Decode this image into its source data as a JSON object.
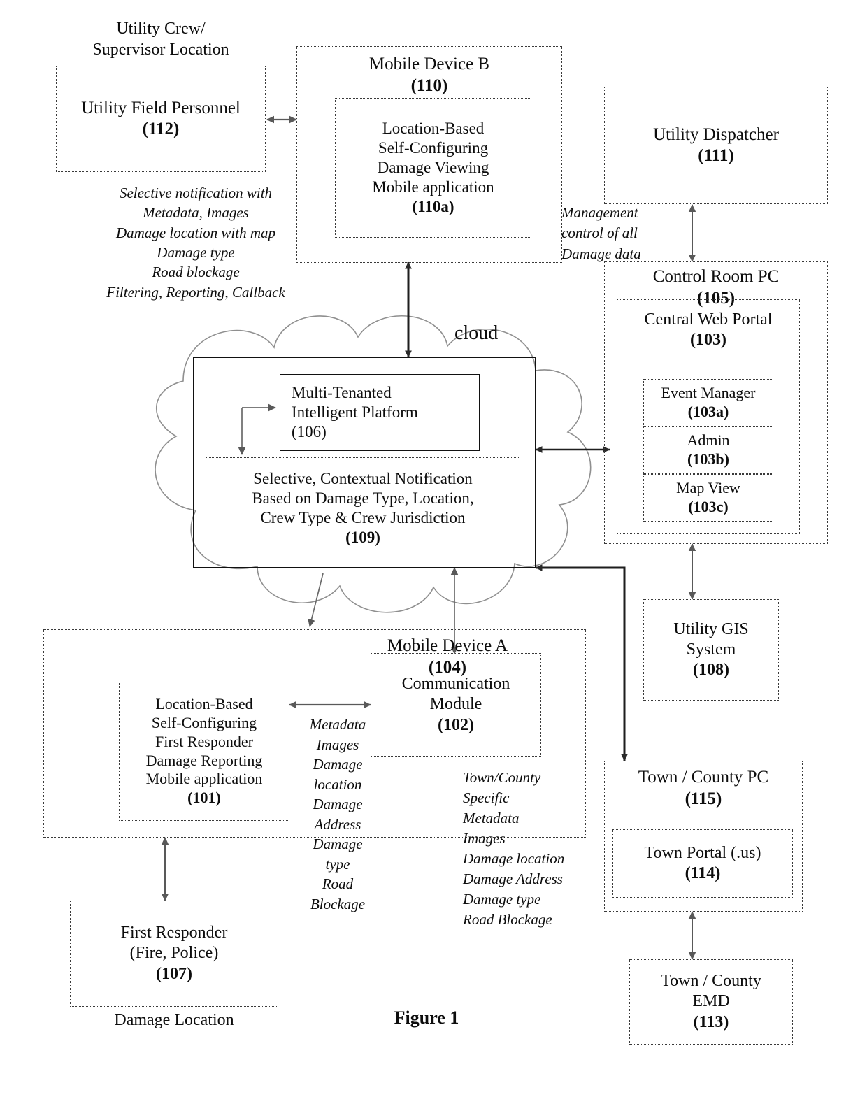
{
  "figure": {
    "caption": "Figure 1",
    "cloud_label": "cloud"
  },
  "labels": {
    "utility_crew_location": "Utility Crew/\nSupervisor Location",
    "damage_location": "Damage Location",
    "selective_notification": "Selective notification with\nMetadata, Images\nDamage location with map\nDamage type\nRoad blockage\nFiltering, Reporting, Callback",
    "management_control": "Management\ncontrol of all\nDamage data",
    "metadata_left": "Metadata\nImages\nDamage\nlocation\nDamage\nAddress\nDamage\ntype\nRoad Blockage",
    "town_county_metadata": "Town/County\nSpecific\nMetadata\nImages\nDamage location\nDamage Address\nDamage type\nRoad Blockage"
  },
  "boxes": {
    "utility_field_personnel": {
      "title": "Utility Field Personnel",
      "number": "(112)"
    },
    "mobile_device_b": {
      "title": "Mobile Device B",
      "number": "(110)"
    },
    "damage_viewing_app": {
      "lines": [
        "Location-Based",
        "Self-Configuring",
        "Damage Viewing",
        "Mobile application"
      ],
      "number": "(110a)"
    },
    "utility_dispatcher": {
      "title": "Utility Dispatcher",
      "number": "(111)"
    },
    "control_room_pc": {
      "title": "Control Room PC",
      "number": "(105)"
    },
    "central_web_portal": {
      "title": "Central Web Portal",
      "number": "(103)"
    },
    "event_manager": {
      "title": "Event Manager",
      "number": "(103a)"
    },
    "admin": {
      "title": "Admin",
      "number": "(103b)"
    },
    "map_view": {
      "title": "Map View",
      "number": "(103c)"
    },
    "platform": {
      "lines": [
        "Multi-Tenanted",
        "Intelligent Platform",
        "(106)"
      ]
    },
    "selective_contextual": {
      "lines": [
        "Selective, Contextual  Notification",
        "Based on Damage Type, Location,",
        "Crew Type & Crew Jurisdiction"
      ],
      "number": "(109)"
    },
    "utility_gis": {
      "lines": [
        "Utility GIS",
        "System"
      ],
      "number": "(108)"
    },
    "mobile_device_a": {
      "title": "Mobile Device A",
      "number": "(104)"
    },
    "first_responder_app": {
      "lines": [
        "Location-Based",
        "Self-Configuring",
        "First Responder",
        "Damage Reporting",
        "Mobile application"
      ],
      "number": "(101)"
    },
    "communication_module": {
      "lines": [
        "Communication",
        "Module"
      ],
      "number": "(102)"
    },
    "first_responder": {
      "lines": [
        "First Responder",
        "(Fire, Police)"
      ],
      "number": "(107)"
    },
    "town_county_pc": {
      "title": "Town / County PC",
      "number": "(115)"
    },
    "town_portal": {
      "title": "Town Portal (.us)",
      "number": "(114)"
    },
    "town_county_emd": {
      "lines": [
        "Town / County",
        "EMD"
      ],
      "number": "(113)"
    }
  },
  "colors": {
    "ink": "#0d0d0d",
    "line": "#3a3a3a",
    "cloud": "#8a8a8a"
  }
}
